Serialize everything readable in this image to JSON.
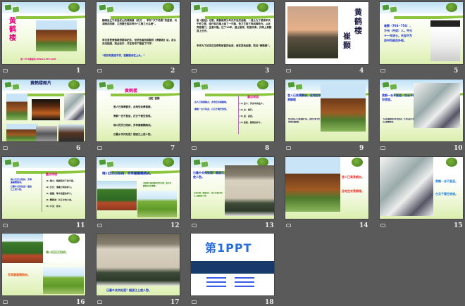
{
  "slides": [
    {
      "number": "1",
      "title": "黄鹤楼",
      "footer": "第一PPT模板网-WWW.1PPT.COM"
    },
    {
      "number": "2",
      "bullets": [
        "巍峨耸立于武昌蛇山的黄鹤楼（武汉），享有“天下绝景”的盛誉，与湖南岳阳楼、江西滕王阁并称为“江南三大名楼”。",
        "李白曾登黄鹤楼想题诗纪念，但恐他看到崔颢的《黄鹤楼》后，自认无法超越，就此收手，只在旁诗下题留了行字：",
        "“眼前有景道不得，崔颢题诗在上头。”"
      ]
    },
    {
      "number": "3",
      "bullets": [
        "据《图经》记载，黄鹤楼原为辛氏开设的酒楼，一道士为了感谢辛氏千杯之恩，临行前在墙上画了一只鹤，告之它能下来起舞助兴。从此宾客踊门，生意兴隆。过了10年，道士复来，取笛吹奏，并跨上黄鹤直上云天。",
        "辛氏为了纪念这位帮助致富的仙翁，便在其地起楼，取名“黄鹤楼”。"
      ]
    },
    {
      "number": "4",
      "title": "黄鹤楼",
      "author": "崔颢"
    },
    {
      "number": "5",
      "bio": "崔颢（704~754），汴州（开封）人。开元十一年进士。天宝中为尚书司勋员外郎。"
    },
    {
      "number": "6",
      "title": "黄鹤楼图片"
    },
    {
      "number": "7",
      "title": "黄鹤楼",
      "author": "【唐】崔颢",
      "lines": [
        "昔人已乘黄鹤去，此地空余黄鹤楼。",
        "黄鹤一去不复返，白云千载空悠悠。",
        "晴川历历汉阳树，芳草萋萋鹦鹉洲。",
        "日暮乡关何处是？烟波江上使人愁。"
      ]
    },
    {
      "number": "8",
      "heading": "重点词语",
      "left": [
        "昔人已乘黄鹤去，此地空余黄鹤楼。",
        "黄鹤一去不复返，白云千载空悠悠。"
      ],
      "notes": [
        "(1) 昔人：传说中的仙人。",
        "(2) 去：离开。",
        "(3) 返：返回。",
        "(4) 悠悠：飘荡的样子。"
      ]
    },
    {
      "number": "9",
      "text": "昔人已乘黄鹤去，此地空余黄鹤楼",
      "small": "昔日的仙人已乘黄鹤飞去，这里只留下空荡荡的黄鹤楼。"
    },
    {
      "number": "10",
      "text": "黄鹤一去不复返，白云千载空悠悠。",
      "small": "飞去的黄鹤再也不会回来，千百年来只有白云飘飘荡荡。"
    },
    {
      "number": "11",
      "heading": "重点词语",
      "left": [
        "晴川历历汉阳树，芳草萋萋鹦鹉洲。",
        "日暮乡关何处是？烟波江上使人愁。"
      ],
      "notes": [
        "(1) 晴川：晴朗阳光下的平原。",
        "(2) 历历：清晰分明的样子。",
        "(3) 萋萋：草木茂盛的样子。",
        "(4) 鹦鹉洲：长江中的小洲。",
        "(5) 乡关：故乡。"
      ]
    },
    {
      "number": "12",
      "text": "晴川历历汉阳树，芳草萋萋鹦鹉洲。",
      "small": "汉阳晴川阁的碧树历历可辨，更可见鹦鹉洲芳草萋萋。"
    },
    {
      "number": "13",
      "text": "日暮乡关何处是？烟波江上使人愁。",
      "small": "天色已晚，眺望远方，故乡在哪儿呢？江上烟波使人愁。"
    },
    {
      "number": "14",
      "lines": [
        "昔人已乘黄鹤去。",
        "此地空余黄鹤楼。"
      ]
    },
    {
      "number": "15",
      "lines": [
        "黄鹤一去不复返。",
        "白云千载空悠悠。"
      ]
    },
    {
      "number": "16",
      "lines": [
        "晴川历历汉阳树。",
        "芳草萋萋鹦鹉洲。"
      ]
    },
    {
      "number": "17",
      "text": "日暮乡关何处是？烟波江上使人愁。"
    },
    {
      "number": "18",
      "logo": "第1PPT"
    }
  ],
  "colors": {
    "background": "#5a5a5a",
    "blue": "#1a2fcc",
    "red": "#e8322a",
    "pink": "#e4007f"
  }
}
